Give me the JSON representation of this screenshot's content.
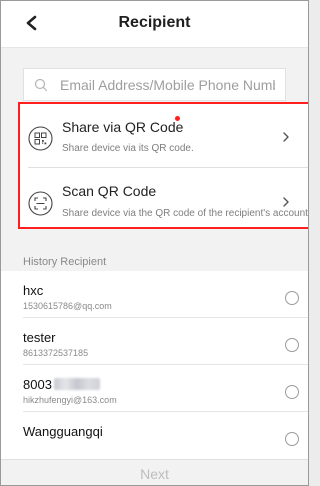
{
  "header": {
    "title": "Recipient",
    "back_icon": "back-icon"
  },
  "search": {
    "placeholder": "Email Address/Mobile Phone Number",
    "value": ""
  },
  "share_options": [
    {
      "label": "Share via QR Code",
      "subtitle": "Share device via its QR code.",
      "icon": "qr-code-icon",
      "has_badge": true
    },
    {
      "label": "Scan QR Code",
      "subtitle": "Share device via the QR code of the recipient's account.",
      "icon": "scan-icon"
    }
  ],
  "history": {
    "title": "History Recipient",
    "items": [
      {
        "name": "hxc",
        "detail": "1530615786@qq.com"
      },
      {
        "name": "tester",
        "detail": "8613372537185"
      },
      {
        "name": "8003",
        "name_obscured": true,
        "detail": "hikzhufengyi@163.com"
      },
      {
        "name": "Wangguangqi",
        "detail": ""
      }
    ]
  },
  "footer": {
    "next_label": "Next"
  },
  "colors": {
    "highlight": "#ff1f1f",
    "badge": "#ff1f1f",
    "disabled_text": "#bdbdbd"
  }
}
